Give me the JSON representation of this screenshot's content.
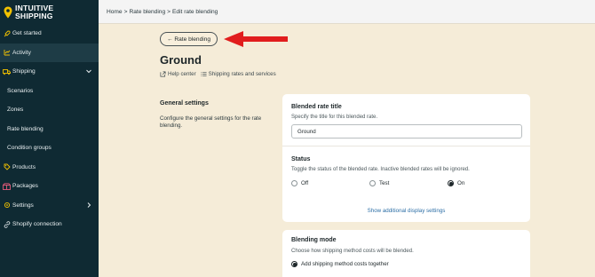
{
  "brand": {
    "line1": "INTUITIVE",
    "line2": "SHIPPING"
  },
  "sidebar": {
    "items": [
      {
        "label": "Get started",
        "icon": "rocket-icon",
        "active": false,
        "sub": false
      },
      {
        "label": "Activity",
        "icon": "chart-icon",
        "active": true,
        "sub": false
      },
      {
        "label": "Shipping",
        "icon": "truck-icon",
        "active": false,
        "sub": false,
        "chevron": "chevron-down-icon"
      },
      {
        "label": "Scenarios",
        "sub": true
      },
      {
        "label": "Zones",
        "sub": true
      },
      {
        "label": "Rate blending",
        "sub": true
      },
      {
        "label": "Condition groups",
        "sub": true
      },
      {
        "label": "Products",
        "icon": "tag-icon",
        "active": false,
        "sub": false
      },
      {
        "label": "Packages",
        "icon": "package-icon",
        "active": false,
        "sub": false
      },
      {
        "label": "Settings",
        "icon": "gear-icon",
        "active": false,
        "sub": false,
        "chevron": "chevron-right-icon"
      },
      {
        "label": "Shopify connection",
        "icon": "link-icon",
        "active": false,
        "sub": false
      }
    ]
  },
  "breadcrumb": {
    "home": "Home",
    "sep1": ">",
    "section": "Rate blending",
    "sep2": ">",
    "current": "Edit rate blending"
  },
  "back_button": "← Rate blending",
  "page_title": "Ground",
  "help_links": {
    "help_center": "Help center",
    "shipping_rates": "Shipping rates and services"
  },
  "general_settings": {
    "title": "General settings",
    "description": "Configure the general settings for the rate blending."
  },
  "card1": {
    "title_label": "Blended rate title",
    "title_help": "Specify the title for this blended rate.",
    "title_value": "Ground",
    "status_label": "Status",
    "status_help": "Toggle the status of the blended rate. Inactive blended rates will be ignored.",
    "status_options": [
      "Off",
      "Test",
      "On"
    ],
    "status_selected": "On",
    "show_more": "Show additional display settings"
  },
  "card2": {
    "mode_label": "Blending mode",
    "mode_help": "Choose how shipping method costs will be blended.",
    "mode_option": "Add shipping method costs together"
  },
  "colors": {
    "sidebar": "#0f2a33",
    "page_bg": "#f5ecd8",
    "accent_arrow": "#e11d1d",
    "link": "#2d6fa6"
  }
}
